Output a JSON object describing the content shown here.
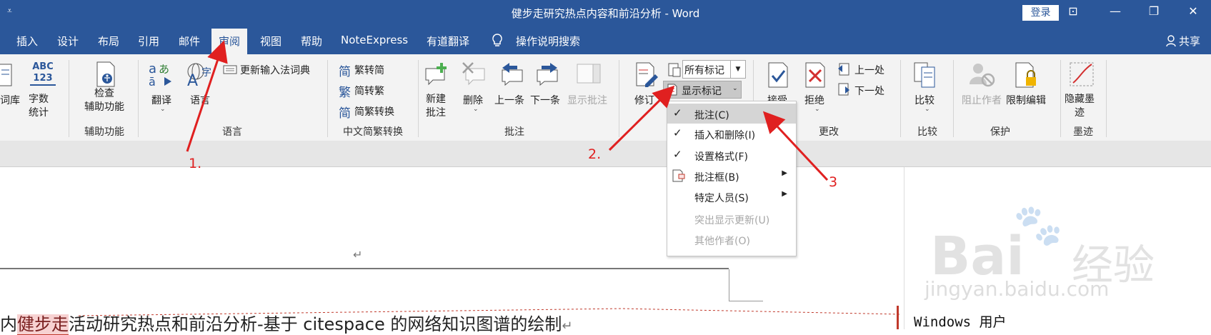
{
  "window": {
    "title": "健步走研究热点内容和前沿分析  -  Word",
    "qat_glyph": "⩡",
    "login_label": "登录",
    "controls": [
      "⊡",
      "—",
      "❐",
      "✕"
    ]
  },
  "tabs": [
    "插入",
    "设计",
    "布局",
    "引用",
    "邮件",
    "审阅",
    "视图",
    "帮助",
    "NoteExpress",
    "有道翻译"
  ],
  "active_tab": "审阅",
  "tell_me": "操作说明搜索",
  "share_label": "共享",
  "ribbon": {
    "proofing": {
      "thesaurus": "同义词库",
      "thesaurus_visible": "词库",
      "wordcount_icon": "ABC\n123",
      "wordcount": "字数\n统计"
    },
    "accessibility": {
      "check": "检查\n辅助功能",
      "group": "辅助功能"
    },
    "language": {
      "translate": "翻译",
      "language_btn": "语言",
      "update_ime": "更新输入法词典",
      "group": "语言"
    },
    "chinese": {
      "to_simplified": "繁转简",
      "to_traditional": "简转繁",
      "convert": "简繁转换",
      "group": "中文简繁转换",
      "icons": [
        "简",
        "繁",
        "简"
      ]
    },
    "comments": {
      "new": "新建\n批注",
      "delete": "删除",
      "prev": "上一条",
      "next": "下一条",
      "show": "显示批注",
      "group": "批注"
    },
    "tracking": {
      "track": "修订",
      "markup_select": "所有标记",
      "show_markup": "显示标记"
    },
    "changes": {
      "accept": "接受",
      "reject": "拒绝",
      "prev": "上一处",
      "next": "下一处",
      "group": "更改"
    },
    "compare": {
      "compare": "比较",
      "group": "比较"
    },
    "protect": {
      "block_authors": "阻止作者",
      "restrict": "限制编辑",
      "group": "保护"
    },
    "ink": {
      "hide_ink": "隐藏墨\n迹",
      "group": "墨迹"
    }
  },
  "menu": {
    "items": [
      {
        "label": "批注(C)",
        "checked": true,
        "highlight": true,
        "disabled": false,
        "submenu": false
      },
      {
        "label": "插入和删除(I)",
        "checked": true,
        "highlight": false,
        "disabled": false,
        "submenu": false
      },
      {
        "label": "设置格式(F)",
        "checked": true,
        "highlight": false,
        "disabled": false,
        "submenu": false
      },
      {
        "label": "批注框(B)",
        "checked": false,
        "highlight": false,
        "disabled": false,
        "submenu": true
      },
      {
        "label": "特定人员(S)",
        "checked": false,
        "highlight": false,
        "disabled": false,
        "submenu": true
      },
      {
        "label": "突出显示更新(U)",
        "checked": false,
        "highlight": false,
        "disabled": true,
        "submenu": false
      },
      {
        "label": "其他作者(O)",
        "checked": false,
        "highlight": false,
        "disabled": true,
        "submenu": false
      }
    ]
  },
  "document": {
    "para_mark": "↵",
    "text_prefix": "内",
    "tracked": "健步走",
    "text_rest": "活动研究热点和前沿分析-基于 citespace 的网络知识图谱的绘制",
    "comment_author": "Windows 用户"
  },
  "annotations": {
    "step1": "1.",
    "step2": "2.",
    "step3": "3",
    "color": "#e02020"
  },
  "watermark": {
    "logo": "Bai",
    "paw": "🐾",
    "cn": "经验",
    "url": "jingyan.baidu.com"
  },
  "colors": {
    "title_bar": "#2b579a",
    "ribbon": "#f3f3f3",
    "accent": "#2b579a"
  }
}
